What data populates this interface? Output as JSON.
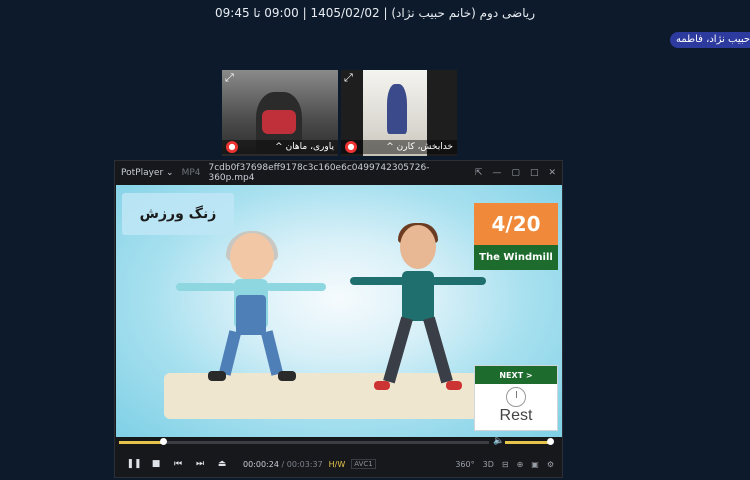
{
  "session": {
    "title": "ریاضی دوم (خانم حبیب نژاد) | 1405/02/02 | 09:00 تا 09:45"
  },
  "user_badge": {
    "label": "حبیب نژاد، فاطمه"
  },
  "participants": [
    {
      "name": "^ یاوری، ماهان",
      "expand_icon": "expand-icon",
      "status_icon": "recording-icon"
    },
    {
      "name": "^ خدابخش، کارن",
      "expand_icon": "expand-icon",
      "status_icon": "recording-icon"
    }
  ],
  "player": {
    "brand": "PotPlayer ⌄",
    "format": "MP4",
    "filename": "7cdb0f37698eff9178c3c160e6c0499742305726-360p.mp4",
    "window_controls": [
      "⇱",
      "—",
      "▢",
      "□",
      "✕"
    ],
    "video": {
      "zang_label": "زنگ ورزش",
      "counter": "4/20",
      "exercise_name": "The Windmill",
      "next_label": "NEXT >",
      "next_rest": "Rest"
    },
    "seek_progress": 0.12,
    "volume_level": 1.0,
    "elapsed": "00:00:24",
    "duration": "/ 00:03:37",
    "hw_label": "H/W",
    "codec": "AVC1",
    "controls": {
      "pause": "❚❚",
      "stop": "■",
      "prev": "⏮",
      "next": "⏭",
      "eject": "⏏"
    },
    "right_controls": [
      "360°",
      "3D",
      "⊟",
      "⊕",
      "▣",
      "⚙"
    ]
  }
}
